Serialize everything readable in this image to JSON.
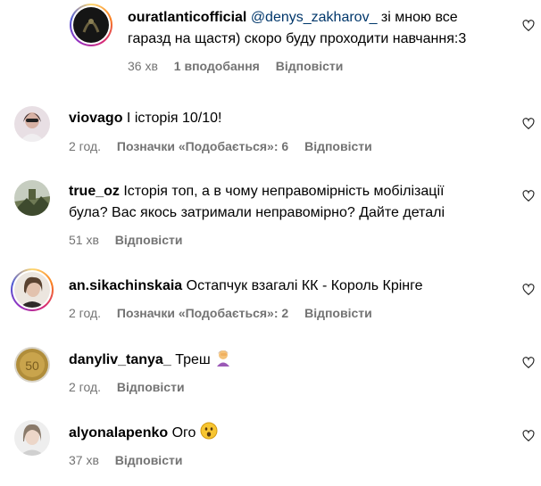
{
  "comments": [
    {
      "username": "ouratlanticofficial",
      "mention": "@denys_zakharov_",
      "text_line1": "зі мною все",
      "text_line2": "гаразд на щастя) скоро буду проходити навчання:3",
      "time": "36 хв",
      "likes": "1 вподобання",
      "reply": "Відповісти"
    },
    {
      "username": "viovago",
      "text": "І історія 10/10!",
      "time": "2 год.",
      "likes": "Позначки «Подобається»: 6",
      "reply": "Відповісти"
    },
    {
      "username": "true_oz",
      "text_line1": "Історія топ, а в чому неправомірність мобілізації",
      "text_line2": "була? Вас якось затримали неправомірно? Дайте деталі",
      "time": "51 хв",
      "reply": "Відповісти"
    },
    {
      "username": "an.sikachinskaia",
      "text": "Остапчук взагалі КК - Король Крінге",
      "time": "2 год.",
      "likes": "Позначки «Подобається»: 2",
      "reply": "Відповісти"
    },
    {
      "username": "danyliv_tanya_",
      "text": "Треш",
      "emoji": "woman-facepalming-emoji",
      "time": "2 год.",
      "reply": "Відповісти"
    },
    {
      "username": "alyonalapenko",
      "text": "Ого",
      "emoji": "astonished-face-emoji",
      "time": "37 хв",
      "reply": "Відповісти"
    }
  ],
  "icons": {
    "like": "heart-outline-icon"
  },
  "colors": {
    "secondary_text": "#737373",
    "mention": "#00376b"
  }
}
